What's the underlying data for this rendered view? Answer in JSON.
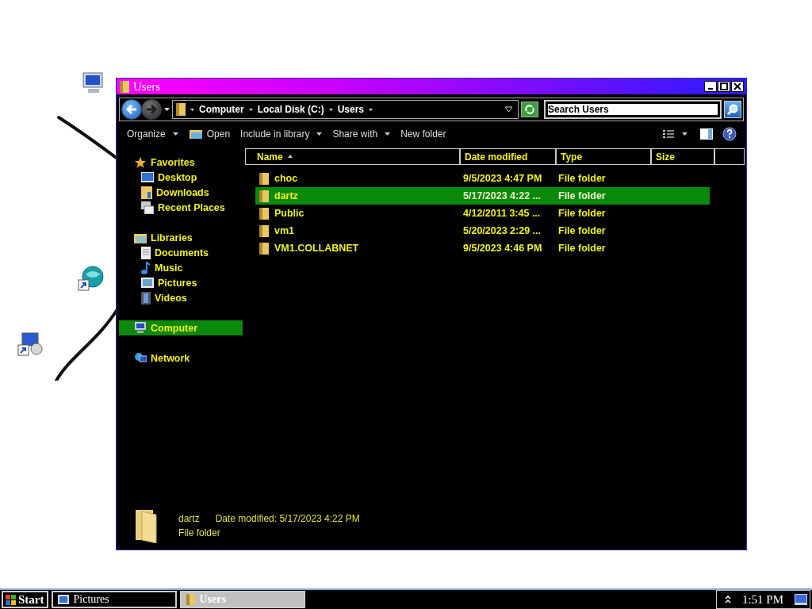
{
  "window": {
    "title": "Users"
  },
  "address": {
    "crumbs": [
      "Computer",
      "Local Disk (C:)",
      "Users"
    ]
  },
  "search": {
    "placeholder": "Search Users"
  },
  "toolbar": [
    {
      "label": "Organize",
      "kind": "menu"
    },
    {
      "label": "Open",
      "kind": "open"
    },
    {
      "label": "Include in library",
      "kind": "menu"
    },
    {
      "label": "Share with",
      "kind": "menu"
    },
    {
      "label": "New folder",
      "kind": "plain"
    }
  ],
  "sidebar": [
    {
      "label": "Favorites",
      "selected": false,
      "children": [
        {
          "label": "Desktop",
          "selected": false
        },
        {
          "label": "Downloads",
          "selected": false
        },
        {
          "label": "Recent Places",
          "selected": false
        }
      ]
    },
    {
      "label": "Libraries",
      "selected": false,
      "children": [
        {
          "label": "Documents",
          "selected": false
        },
        {
          "label": "Music",
          "selected": false
        },
        {
          "label": "Pictures",
          "selected": false
        },
        {
          "label": "Videos",
          "selected": false
        }
      ]
    },
    {
      "label": "Computer",
      "selected": true
    },
    {
      "label": "Network",
      "selected": false
    }
  ],
  "columns": [
    {
      "label": "Name",
      "sorted": true
    },
    {
      "label": "Date modified",
      "sorted": false
    },
    {
      "label": "Type",
      "sorted": false
    },
    {
      "label": "Size",
      "sorted": false
    }
  ],
  "rows": [
    {
      "name": "choc",
      "date": "9/5/2023 4:47 PM",
      "type": "File folder",
      "selected": false
    },
    {
      "name": "dartz",
      "date": "5/17/2023 4:22 ...",
      "type": "File folder",
      "selected": true
    },
    {
      "name": "Public",
      "date": "4/12/2011 3:45 ...",
      "type": "File folder",
      "selected": false
    },
    {
      "name": "vm1",
      "date": "5/20/2023 2:29 ...",
      "type": "File folder",
      "selected": false
    },
    {
      "name": "VM1.COLLABNET",
      "date": "9/5/2023 4:46 PM",
      "type": "File folder",
      "selected": false
    }
  ],
  "details": {
    "name": "dartz",
    "modified": "Date modified: 5/17/2023 4:22 PM",
    "type": "File folder"
  },
  "taskbar": {
    "start": "Start",
    "tasks": [
      {
        "label": "Pictures",
        "selected": false
      },
      {
        "label": "Users",
        "selected": true
      }
    ],
    "clock": "1:51 PM"
  }
}
